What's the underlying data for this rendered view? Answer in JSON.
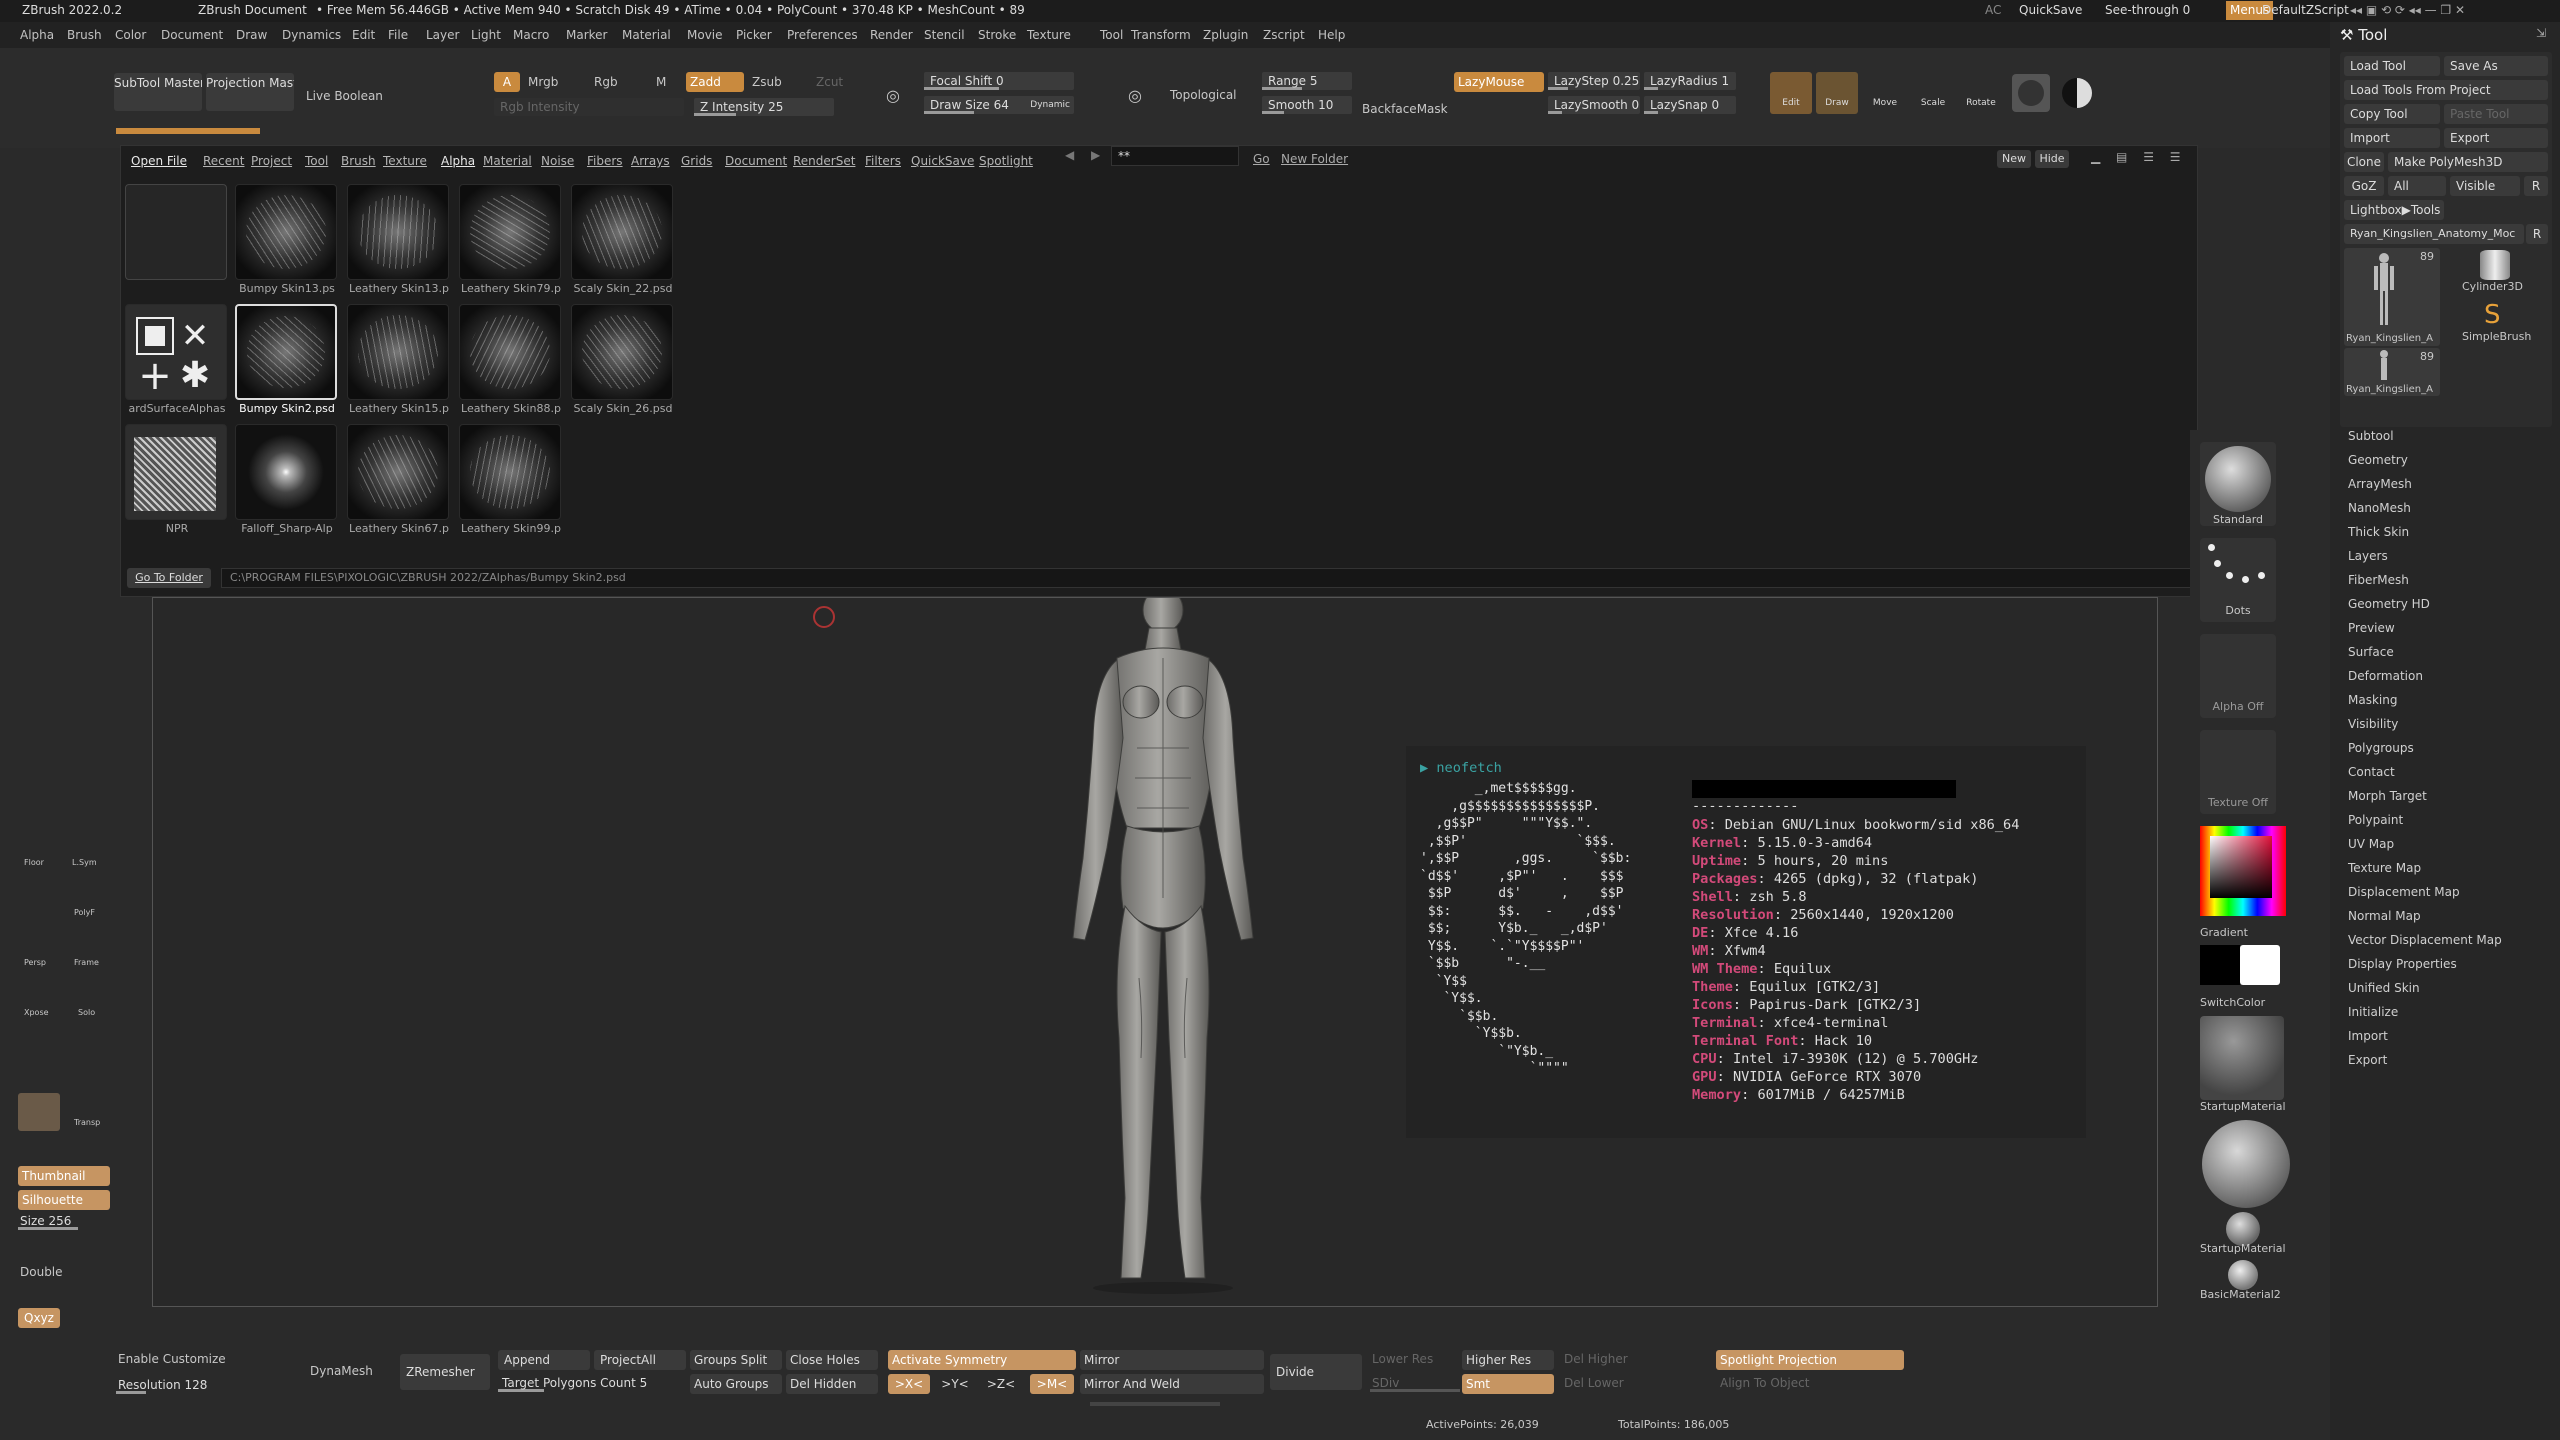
{
  "titlebar": {
    "app": "ZBrush 2022.0.2",
    "document": "ZBrush Document",
    "stats": "• Free Mem 56.446GB • Active Mem 940 • Scratch Disk 49 • ATime • 0.04 • PolyCount • 370.48 KP • MeshCount • 89",
    "ac": "AC",
    "quicksave": "QuickSave",
    "seethrough": "See-through  0",
    "menus": "Menus",
    "script": "DefaultZScript"
  },
  "menubar": [
    "Alpha",
    "Brush",
    "Color",
    "Document",
    "Draw",
    "Dynamics",
    "Edit",
    "File",
    "Layer",
    "Light",
    "Macro",
    "Marker",
    "Material",
    "Movie",
    "Picker",
    "Preferences",
    "Render",
    "Stencil",
    "Stroke",
    "Texture",
    "Tool",
    "Transform",
    "Zplugin",
    "Zscript",
    "Help"
  ],
  "topshelf": {
    "subtool_master": "SubTool Master",
    "projection_master": "Projection Master",
    "live_boolean": "Live Boolean",
    "a": "A",
    "mrgb": "Mrgb",
    "rgb": "Rgb",
    "m": "M",
    "zadd": "Zadd",
    "zsub": "Zsub",
    "zcut": "Zcut",
    "rgb_intensity": "Rgb Intensity",
    "z_intensity": "Z Intensity 25",
    "z_intensity_value": 0.25,
    "focal_shift": "Focal Shift 0",
    "draw_size": "Draw Size 64",
    "dynamic": "Dynamic",
    "topological": "Topological",
    "range": "Range 5",
    "smooth": "Smooth 10",
    "backfacemask": "BackfaceMask",
    "lazymouse": "LazyMouse",
    "lazystep": "LazyStep 0.25",
    "lazyradius": "LazyRadius 1",
    "lazysmooth": "LazySmooth 0",
    "lazysnap": "LazySnap 0",
    "edit": "Edit",
    "draw": "Draw",
    "move": "Move",
    "scale": "Scale",
    "rotate": "Rotate"
  },
  "popup": {
    "tabs": [
      "Open File",
      "Recent",
      "Project",
      "Tool",
      "Brush",
      "Texture",
      "Alpha",
      "Material",
      "Noise",
      "Fibers",
      "Arrays",
      "Grids",
      "Document",
      "RenderSet",
      "Filters",
      "QuickSave",
      "Spotlight"
    ],
    "search_value": "**",
    "go": "Go",
    "new_folder": "New Folder",
    "new": "New",
    "hide": "Hide",
    "go_to_folder": "Go To Folder",
    "path": "C:\\PROGRAM FILES\\PIXOLOGIC\\ZBRUSH 2022/ZAlphas/Bumpy Skin2.psd",
    "items": [
      {
        "label": ""
      },
      {
        "label": "Bumpy Skin13.ps"
      },
      {
        "label": "Leathery Skin13.p"
      },
      {
        "label": "Leathery Skin79.p"
      },
      {
        "label": "Scaly Skin_22.psd"
      },
      {
        "label": "ardSurfaceAlphas"
      },
      {
        "label": "Bumpy Skin2.psd"
      },
      {
        "label": "Leathery Skin15.p"
      },
      {
        "label": "Leathery Skin88.p"
      },
      {
        "label": "Scaly Skin_26.psd"
      },
      {
        "label": "NPR"
      },
      {
        "label": "Falloff_Sharp-Alp"
      },
      {
        "label": "Leathery Skin67.p"
      },
      {
        "label": "Leathery Skin99.p"
      }
    ]
  },
  "terminal": {
    "prompt": "▶ neofetch",
    "logo": [
      "       _,met$$$$$gg.",
      "    ,g$$$$$$$$$$$$$$$P.",
      "  ,g$$P\"     \"\"\"Y$$.\".",
      " ,$$P'              `$$$.",
      "',$$P       ,ggs.     `$$b:",
      "`d$$'     ,$P\"'   .    $$$",
      " $$P      d$'     ,    $$P",
      " $$:      $$.   -    ,d$$'",
      " $$;      Y$b._   _,d$P'",
      " Y$$.    `.`\"Y$$$$P\"'",
      " `$$b      \"-.__",
      "  `Y$$",
      "   `Y$$.",
      "     `$$b.",
      "       `Y$$b.",
      "          `\"Y$b._",
      "              `\"\"\"\""
    ],
    "separator": "-------------",
    "info": [
      {
        "k": "OS",
        "v": "Debian GNU/Linux bookworm/sid x86_64"
      },
      {
        "k": "Kernel",
        "v": "5.15.0-3-amd64"
      },
      {
        "k": "Uptime",
        "v": "5 hours, 20 mins"
      },
      {
        "k": "Packages",
        "v": "4265 (dpkg), 32 (flatpak)"
      },
      {
        "k": "Shell",
        "v": "zsh 5.8"
      },
      {
        "k": "Resolution",
        "v": "2560x1440, 1920x1200"
      },
      {
        "k": "DE",
        "v": "Xfce 4.16"
      },
      {
        "k": "WM",
        "v": "Xfwm4"
      },
      {
        "k": "WM Theme",
        "v": "Equilux"
      },
      {
        "k": "Theme",
        "v": "Equilux [GTK2/3]"
      },
      {
        "k": "Icons",
        "v": "Papirus-Dark [GTK2/3]"
      },
      {
        "k": "Terminal",
        "v": "xfce4-terminal"
      },
      {
        "k": "Terminal Font",
        "v": "Hack 10"
      },
      {
        "k": "CPU",
        "v": "Intel i7-3930K (12) @ 5.700GHz"
      },
      {
        "k": "GPU",
        "v": "NVIDIA GeForce RTX 3070"
      },
      {
        "k": "Memory",
        "v": "6017MiB / 64257MiB"
      }
    ]
  },
  "leftpanel": {
    "floor": "Floor",
    "lsym": "L.Sym",
    "polyf": "PolyF",
    "persp": "Persp",
    "frame": "Frame",
    "xpose": "Xpose",
    "solo": "Solo",
    "transp": "Transp",
    "thumbnail": "Thumbnail",
    "silhouette": "Silhouette",
    "size": "Size 256",
    "double": "Double",
    "xyz": "Qxyz"
  },
  "rightstrip": {
    "standard": "Standard",
    "dots": "Dots",
    "alpha_off": "Alpha Off",
    "texture_off": "Texture Off",
    "gradient": "Gradient",
    "switchcolor": "SwitchColor",
    "startup_material": "StartupMaterial",
    "startup_material2": "StartupMaterial",
    "basic_material2": "BasicMaterial2"
  },
  "toolpanel": {
    "title": "Tool",
    "load_tool": "Load Tool",
    "save_as": "Save As",
    "load_from_project": "Load Tools From Project",
    "copy_tool": "Copy Tool",
    "paste_tool": "Paste Tool",
    "import": "Import",
    "export": "Export",
    "clone": "Clone",
    "make_polymesh": "Make PolyMesh3D",
    "goz": "GoZ",
    "all": "All",
    "visible": "Visible",
    "r": "R",
    "lightbox_tools": "Lightbox▶Tools",
    "current_tool": "Ryan_Kingslien_Anatomy_Moc",
    "r2": "R",
    "count1": "89",
    "count2": "89",
    "tool1": "Ryan_Kingslien_A",
    "tool2": "Cylinder3D",
    "tool3": "SimpleBrush",
    "tool4": "Ryan_Kingslien_A",
    "menu": [
      "Subtool",
      "Geometry",
      "ArrayMesh",
      "NanoMesh",
      "Thick Skin",
      "Layers",
      "FiberMesh",
      "Geometry HD",
      "Preview",
      "Surface",
      "Deformation",
      "Masking",
      "Visibility",
      "Polygroups",
      "Contact",
      "Morph Target",
      "Polypaint",
      "UV Map",
      "Texture Map",
      "Displacement Map",
      "Normal Map",
      "Vector Displacement Map",
      "Display Properties",
      "Unified Skin",
      "Initialize",
      "Import",
      "Export"
    ]
  },
  "bottomshelf": {
    "enable_customize": "Enable Customize",
    "resolution": "Resolution 128",
    "dynamesh": "DynaMesh",
    "zremesher": "ZRemesher",
    "append": "Append",
    "projectall": "ProjectAll",
    "groups_split": "Groups Split",
    "close_holes": "Close Holes",
    "target_polygons": "Target Polygons Count 5",
    "auto_groups": "Auto Groups",
    "del_hidden": "Del Hidden",
    "activate_symmetry": "Activate Symmetry",
    "x": ">X<",
    "y": ">Y<",
    "z": ">Z<",
    "m": ">M<",
    "mirror": "Mirror",
    "mirror_weld": "Mirror And Weld",
    "divide": "Divide",
    "lower_res": "Lower Res",
    "higher_res": "Higher Res",
    "del_higher": "Del Higher",
    "sdiv": "SDiv",
    "smt": "Smt",
    "del_lower": "Del Lower",
    "spotlight_projection": "Spotlight Projection",
    "align_to_object": "Align To Object",
    "active_points": "ActivePoints: 26,039",
    "total_points": "TotalPoints: 186,005"
  }
}
